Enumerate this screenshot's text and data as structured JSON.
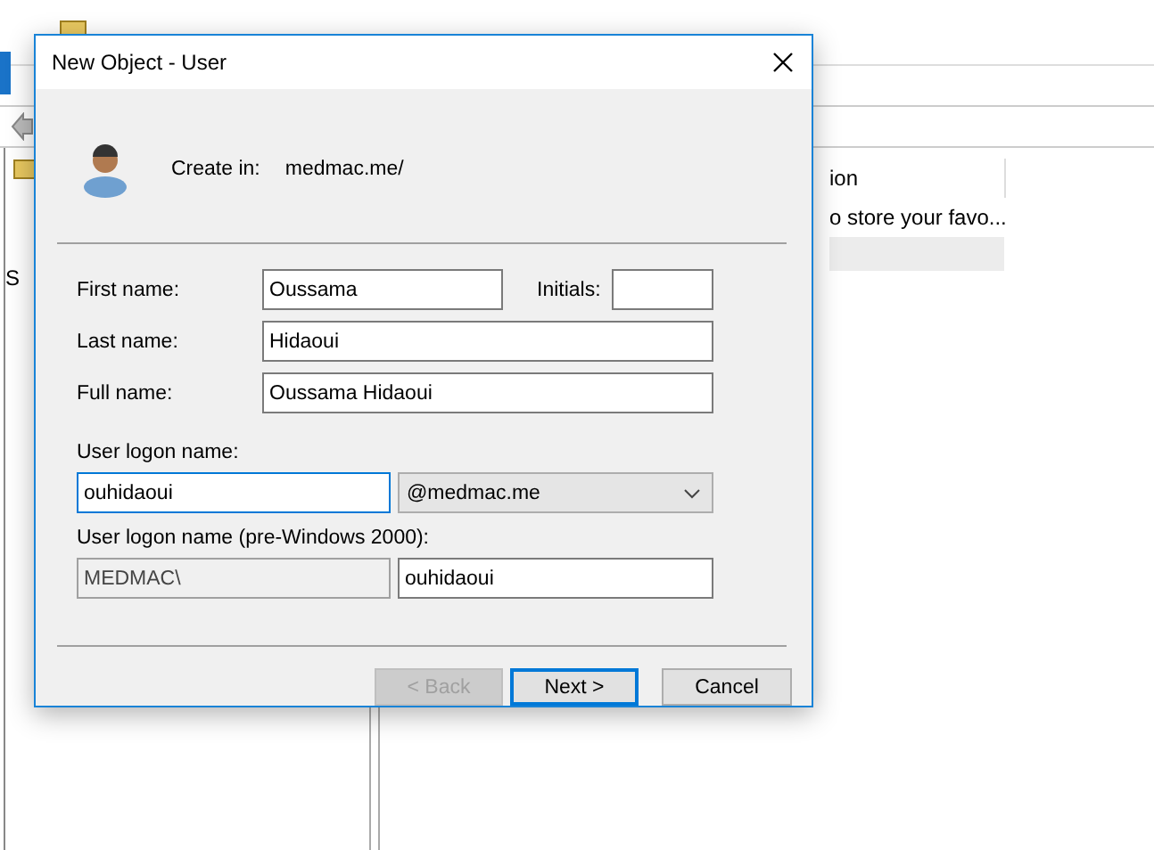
{
  "background_window": {
    "tree_fragment": "S",
    "list": {
      "column_1": "ion",
      "rows": [
        "o store your favo..."
      ]
    }
  },
  "dialog": {
    "title": "New Object - User",
    "create_in": {
      "label": "Create in:",
      "value": "medmac.me/"
    },
    "first_name": {
      "label": "First name:",
      "value": "Oussama"
    },
    "initials": {
      "label": "Initials:"
    },
    "last_name": {
      "label": "Last name:",
      "value": "Hidaoui"
    },
    "full_name": {
      "label": "Full name:",
      "value": "Oussama Hidaoui"
    },
    "logon_name": {
      "label": "User logon name:",
      "value": "ouhidaoui",
      "focused": true
    },
    "domain": {
      "value": "@medmac.me"
    },
    "pre2000": {
      "label": "User logon name (pre-Windows 2000):",
      "prefix": {
        "value": "MEDMAC\\",
        "disabled": true
      },
      "value": "ouhidaoui"
    },
    "buttons": [
      {
        "label": "< Back",
        "disabled": true,
        "default": false
      },
      {
        "label": "Next >",
        "disabled": false,
        "default": true
      },
      {
        "label": "Cancel",
        "disabled": false,
        "default": false
      }
    ]
  }
}
